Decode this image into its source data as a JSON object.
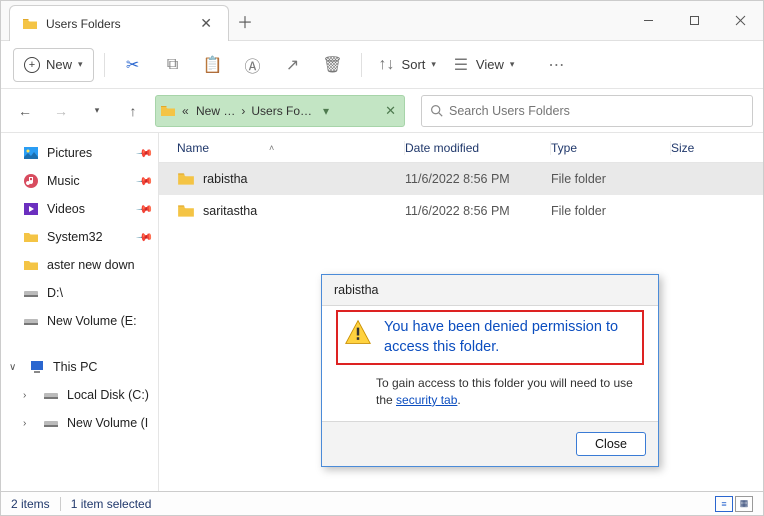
{
  "titlebar": {
    "tab_title": "Users Folders"
  },
  "toolbar": {
    "new_label": "New",
    "sort_label": "Sort",
    "view_label": "View"
  },
  "address": {
    "crumb1": "New …",
    "crumb2": "Users Fo…"
  },
  "search": {
    "placeholder": "Search Users Folders"
  },
  "sidebar": {
    "items": [
      {
        "label": "Pictures",
        "icon": "pictures-icon"
      },
      {
        "label": "Music",
        "icon": "music-icon"
      },
      {
        "label": "Videos",
        "icon": "videos-icon"
      },
      {
        "label": "System32",
        "icon": "folder-icon"
      },
      {
        "label": "aster new down",
        "icon": "folder-icon"
      },
      {
        "label": "D:\\",
        "icon": "drive-icon"
      },
      {
        "label": "New Volume (E:",
        "icon": "drive-icon"
      }
    ],
    "thispc": "This PC",
    "local_c": "Local Disk (C:)",
    "new_vol": "New Volume (I"
  },
  "columns": {
    "name": "Name",
    "date": "Date modified",
    "type": "Type",
    "size": "Size"
  },
  "rows": [
    {
      "name": "rabistha",
      "date": "11/6/2022 8:56 PM",
      "type": "File folder"
    },
    {
      "name": "saritastha",
      "date": "11/6/2022 8:56 PM",
      "type": "File folder"
    }
  ],
  "status": {
    "count": "2 items",
    "selected": "1 item selected"
  },
  "dialog": {
    "title": "rabistha",
    "message": "You have been denied permission to access this folder.",
    "sub_pre": "To gain access to this folder you will need to use the ",
    "sub_link": "security tab",
    "sub_post": ".",
    "close": "Close"
  }
}
